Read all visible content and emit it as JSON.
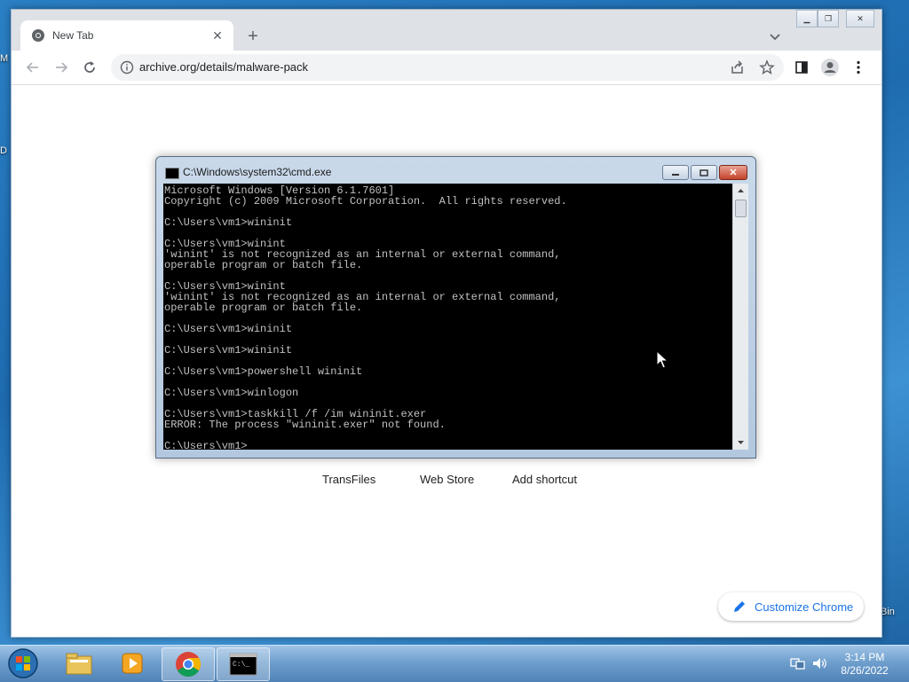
{
  "desktop": {
    "edge_labels": [
      "M",
      "D",
      "Bin"
    ]
  },
  "chrome": {
    "tab": {
      "title": "New Tab",
      "close": "✕"
    },
    "new_tab": "+",
    "tab_search": "⌄",
    "toolbar": {
      "back": "←",
      "forward": "→",
      "reload": "↻"
    },
    "omnibox": {
      "url": "archive.org/details/malware-pack"
    },
    "shortcuts": [
      "TransFiles",
      "Web Store",
      "Add shortcut"
    ],
    "customize_label": "Customize Chrome"
  },
  "cmd": {
    "title": "C:\\Windows\\system32\\cmd.exe",
    "lines": [
      "Microsoft Windows [Version 6.1.7601]",
      "Copyright (c) 2009 Microsoft Corporation.  All rights reserved.",
      "",
      "C:\\Users\\vm1>wininit",
      "",
      "C:\\Users\\vm1>winint",
      "'winint' is not recognized as an internal or external command,",
      "operable program or batch file.",
      "",
      "C:\\Users\\vm1>winint",
      "'winint' is not recognized as an internal or external command,",
      "operable program or batch file.",
      "",
      "C:\\Users\\vm1>wininit",
      "",
      "C:\\Users\\vm1>wininit",
      "",
      "C:\\Users\\vm1>powershell wininit",
      "",
      "C:\\Users\\vm1>winlogon",
      "",
      "C:\\Users\\vm1>taskkill /f /im wininit.exer",
      "ERROR: The process \"wininit.exer\" not found.",
      "",
      "C:\\Users\\vm1>"
    ]
  },
  "taskbar": {
    "apps": [
      "start-orb",
      "file-explorer",
      "media-player",
      "chrome",
      "cmd"
    ],
    "clock": {
      "time": "3:14 PM",
      "date": "8/26/2022"
    }
  },
  "colors": {
    "accent": "#1a73e8",
    "cmd_text": "#c0c0c0",
    "cmd_bg": "#000000"
  }
}
